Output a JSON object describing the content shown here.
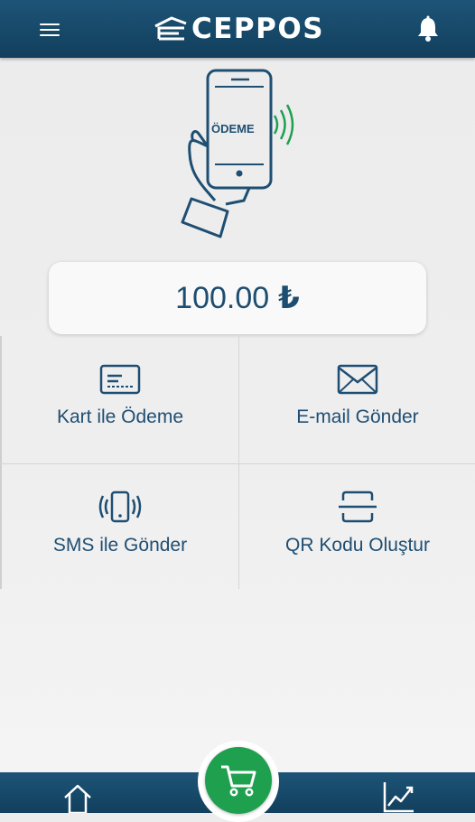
{
  "header": {
    "brand": "CEPPOS",
    "menu_icon": "hamburger-menu-icon",
    "notification_icon": "bell-icon"
  },
  "hero": {
    "phone_text": "ÖDEME",
    "icon": "phone-nfc-payment-illustration"
  },
  "payment": {
    "amount": "100.00",
    "currency": "₺"
  },
  "actions": [
    {
      "label": "Kart ile Ödeme",
      "icon": "credit-card-icon"
    },
    {
      "label": "E-mail Gönder",
      "icon": "envelope-icon"
    },
    {
      "label": "SMS ile Gönder",
      "icon": "vibrating-phone-icon"
    },
    {
      "label": "QR Kodu Oluştur",
      "icon": "qr-scan-icon"
    }
  ],
  "bottom_nav": {
    "home_icon": "home-icon",
    "cart_icon": "shopping-cart-icon",
    "stats_icon": "chart-icon"
  },
  "colors": {
    "primary": "#1d5477",
    "text": "#1f4e73",
    "accent_green": "#1ea04f"
  }
}
